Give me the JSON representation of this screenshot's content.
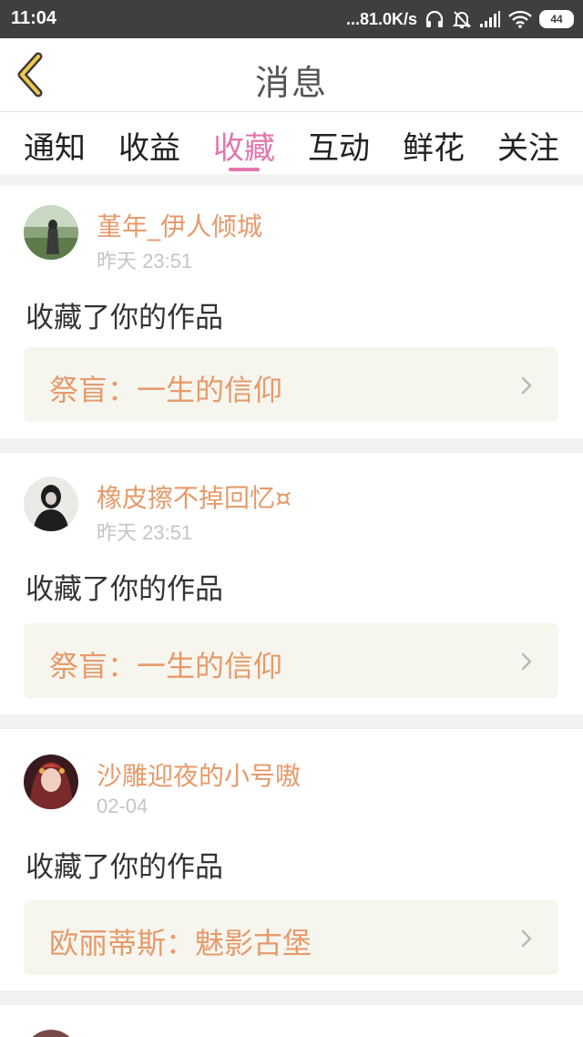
{
  "status_bar": {
    "time": "11:04",
    "net_speed": "...81.0K/s",
    "battery": "44"
  },
  "nav": {
    "title": "消息"
  },
  "tabs": [
    {
      "label": "通知",
      "active": false
    },
    {
      "label": "收益",
      "active": false
    },
    {
      "label": "收藏",
      "active": true
    },
    {
      "label": "互动",
      "active": false
    },
    {
      "label": "鲜花",
      "active": false
    },
    {
      "label": "关注",
      "active": false
    }
  ],
  "messages": [
    {
      "username": "堇年_伊人倾城",
      "timestamp": "昨天 23:51",
      "action": "收藏了你的作品",
      "work_title": "祭盲：一生的信仰"
    },
    {
      "username": "橡皮擦不掉回忆¤",
      "timestamp": "昨天 23:51",
      "action": "收藏了你的作品",
      "work_title": "祭盲：一生的信仰"
    },
    {
      "username": "沙雕迎夜的小号嗷",
      "timestamp": "02-04",
      "action": "收藏了你的作品",
      "work_title": "欧丽蒂斯：魅影古堡"
    }
  ],
  "colors": {
    "accent_pink": "#e276ad",
    "name_orange": "#e79a6b",
    "status_bar": "#3f3f3f"
  }
}
